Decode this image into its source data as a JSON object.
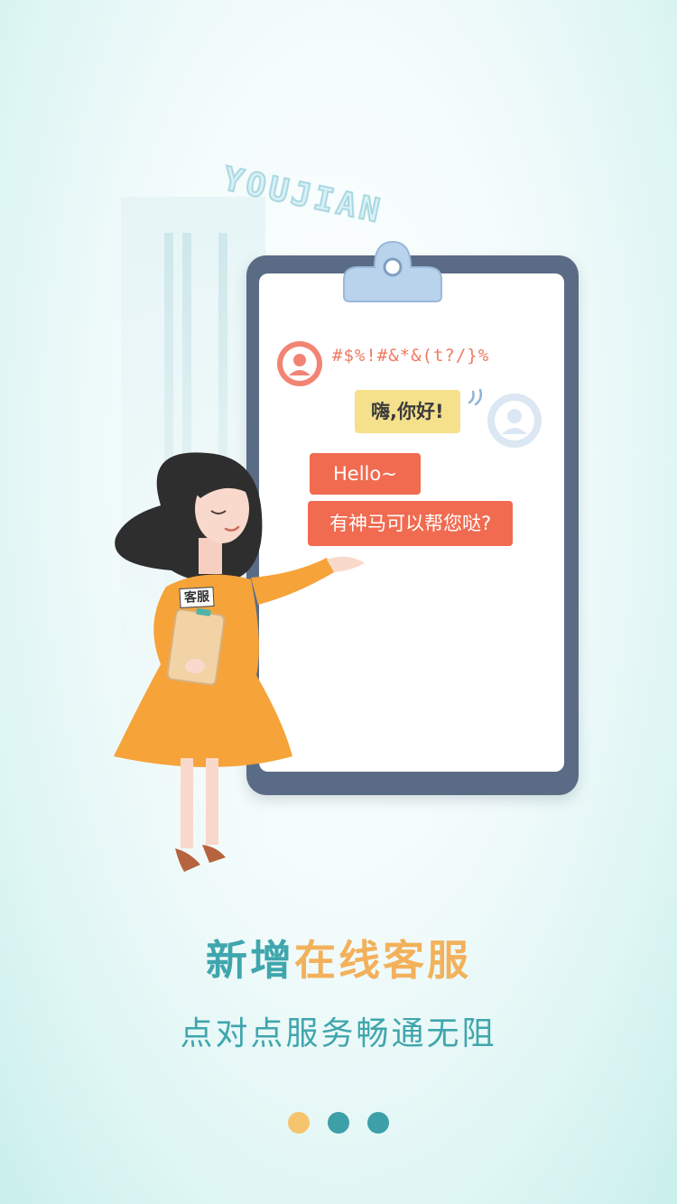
{
  "illustration": {
    "brand_wordmark": "YOUJIAN",
    "chat": {
      "garbled_message": "#$%!#&*&(t?/}%",
      "greeting_message": "嗨,你好!",
      "hello_message": "Hello~",
      "offer_message": "有神马可以帮您哒?"
    },
    "agent_tag": "客服",
    "colors": {
      "clipboard": "#5a6b85",
      "chat_orange": "#f06b50",
      "chat_yellow": "#f5e08c",
      "dress": "#f6a33a"
    }
  },
  "headline": {
    "lead": "新增",
    "accent": "在线客服"
  },
  "subtitle": "点对点服务畅通无阻",
  "pager": {
    "active_index": 0,
    "dots": [
      {
        "label": "page-1",
        "color": "#f7c46e"
      },
      {
        "label": "page-2",
        "color": "#3d9fa8"
      },
      {
        "label": "page-3",
        "color": "#3d9fa8"
      }
    ]
  }
}
